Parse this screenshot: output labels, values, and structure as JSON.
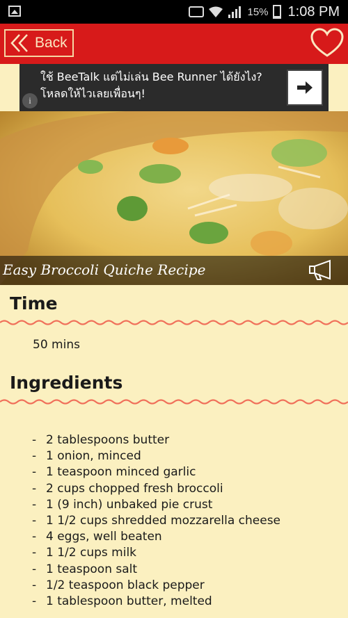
{
  "status_bar": {
    "battery": "15%",
    "time": "1:08 PM"
  },
  "app_bar": {
    "back_label": "Back"
  },
  "ad": {
    "text": "ใช้ BeeTalk แต่ไม่เล่น Bee Runner ได้ยังไง? โหลดให้ไวเลยเพื่อนๆ!",
    "info_glyph": "i"
  },
  "recipe": {
    "title": "Easy Broccoli Quiche Recipe",
    "time_heading": "Time",
    "time_value": "50 mins",
    "ingredients_heading": "Ingredients",
    "ingredients": [
      "2 tablespoons butter",
      "1 onion, minced",
      "1 teaspoon minced garlic",
      "2 cups chopped fresh broccoli",
      "1 (9 inch) unbaked pie crust",
      "1 1/2 cups shredded mozzarella cheese",
      "4 eggs, well beaten",
      "1 1/2 cups milk",
      "1 teaspoon salt",
      "1/2 teaspoon black pepper",
      "1 tablespoon butter, melted"
    ]
  },
  "colors": {
    "app_bar": "#d71a1a",
    "background": "#fbf0c0",
    "wave": "#f0705a"
  }
}
